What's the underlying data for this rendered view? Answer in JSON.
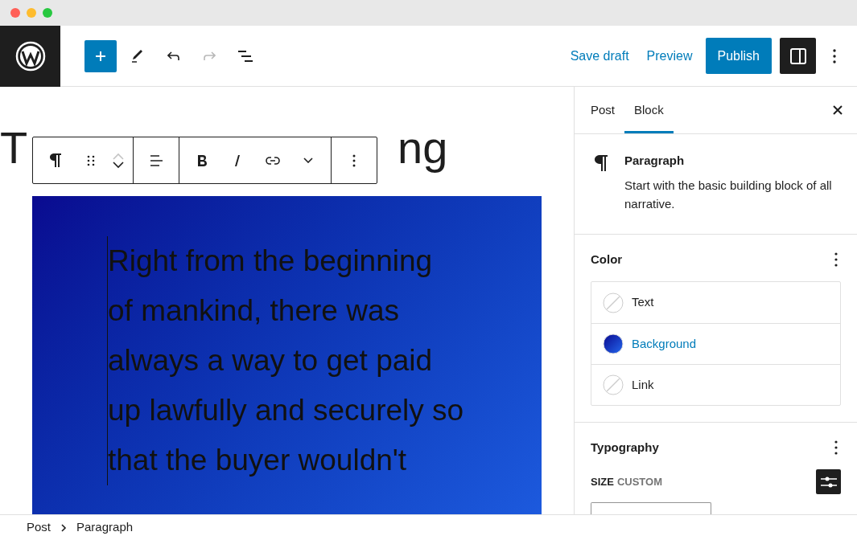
{
  "header": {
    "tools": [
      {
        "kind": "inserter",
        "disabled": false
      },
      {
        "kind": "pencil",
        "disabled": false
      },
      {
        "kind": "undo",
        "disabled": false
      },
      {
        "kind": "redo",
        "disabled": true
      },
      {
        "kind": "outline",
        "disabled": false
      }
    ],
    "actions": [
      {
        "label": "Save draft",
        "kind": "link"
      },
      {
        "label": "Preview",
        "kind": "link"
      },
      {
        "label": "Publish",
        "kind": "primary"
      }
    ],
    "settings_toggle": {
      "on": true
    }
  },
  "editor": {
    "title_visible_start": "T",
    "title_visible_end": "ng",
    "block_toolbar": {
      "move_up_disabled": true
    },
    "paragraph_lines": [
      "Right from the beginning",
      "of mankind, there was",
      "always a way to get paid",
      "up lawfully and securely so",
      "that the buyer wouldn't"
    ]
  },
  "sidebar": {
    "tabs": [
      {
        "label": "Post",
        "selected": false
      },
      {
        "label": "Block",
        "selected": true
      }
    ],
    "block_card": {
      "name": "Paragraph",
      "description": "Start with the basic building block of all narrative."
    },
    "color": {
      "title": "Color",
      "items": [
        {
          "label": "Text",
          "kind": "none",
          "selected": false
        },
        {
          "label": "Background",
          "kind": "gradient",
          "selected": true
        },
        {
          "label": "Link",
          "kind": "none",
          "selected": false
        }
      ]
    },
    "typography": {
      "title": "Typography",
      "size_label": "SIZE",
      "size_value": "CUSTOM"
    }
  },
  "breadcrumb": [
    "Post",
    "Paragraph"
  ]
}
